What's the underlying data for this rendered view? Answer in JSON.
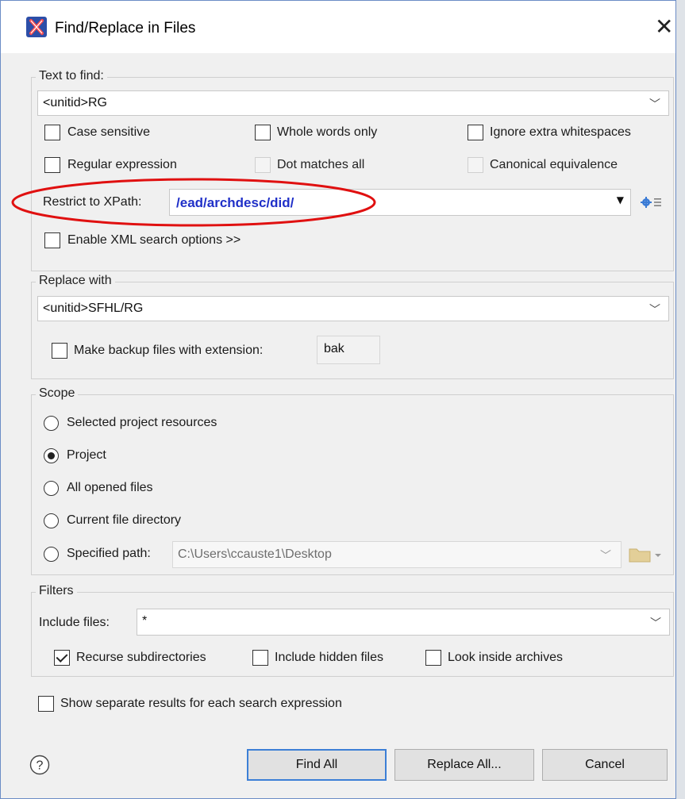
{
  "window": {
    "title": "Find/Replace in Files",
    "close_glyph": "✕",
    "app_icon": "oxygen-x-icon"
  },
  "text_to_find": {
    "group_label": "Text to find:",
    "value": "<unitid>RG",
    "options": [
      {
        "label": "Case sensitive",
        "checked": false,
        "enabled": true
      },
      {
        "label": "Whole words only",
        "checked": false,
        "enabled": true
      },
      {
        "label": "Ignore extra whitespaces",
        "checked": false,
        "enabled": true
      },
      {
        "label": "Regular expression",
        "checked": false,
        "enabled": true
      },
      {
        "label": "Dot matches all",
        "checked": false,
        "enabled": false
      },
      {
        "label": "Canonical equivalence",
        "checked": false,
        "enabled": false
      }
    ],
    "xpath_label": "Restrict to XPath:",
    "xpath_parts": [
      "/",
      "ead",
      "/",
      "archdesc",
      "/",
      "did",
      "/"
    ],
    "xml_options_label": "Enable XML search options >>"
  },
  "replace_with": {
    "group_label": "Replace with",
    "value": "<unitid>SFHL/RG",
    "backup_label": "Make backup files with extension:",
    "backup_ext": "bak"
  },
  "scope": {
    "group_label": "Scope",
    "options": [
      {
        "label": "Selected project resources",
        "selected": false
      },
      {
        "label": "Project",
        "selected": true
      },
      {
        "label": "All opened files",
        "selected": false
      },
      {
        "label": "Current file directory",
        "selected": false
      },
      {
        "label": "Specified path:",
        "selected": false
      }
    ],
    "specified_path": "C:\\Users\\ccauste1\\Desktop"
  },
  "filters": {
    "group_label": "Filters",
    "include_label": "Include files:",
    "include_value": "*",
    "options": [
      {
        "label": "Recurse subdirectories",
        "checked": true
      },
      {
        "label": "Include hidden files",
        "checked": false
      },
      {
        "label": "Look inside archives",
        "checked": false
      }
    ]
  },
  "separate_results_label": "Show separate results for each search expression",
  "buttons": {
    "help": "?",
    "find_all": "Find All",
    "replace_all": "Replace All...",
    "cancel": "Cancel"
  },
  "colors": {
    "xpath_text": "#2030c8",
    "highlight": "#e01010",
    "default_button_border": "#3c7fd6"
  }
}
